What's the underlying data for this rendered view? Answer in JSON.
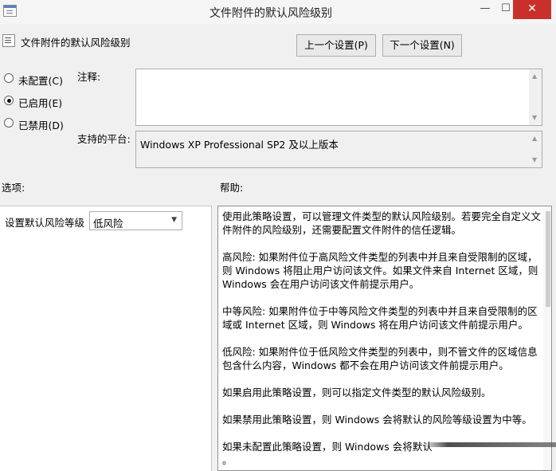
{
  "window": {
    "title": "文件附件的默认风险级别",
    "minimize_glyph": "—",
    "maximize_glyph": "☐",
    "close_glyph": "✕"
  },
  "header": {
    "policy_name": "文件附件的默认风险级别",
    "prev_button": "上一个设置(P)",
    "next_button": "下一个设置(N)"
  },
  "state": {
    "options": [
      {
        "label": "未配置(C)",
        "checked": false
      },
      {
        "label": "已启用(E)",
        "checked": true
      },
      {
        "label": "已禁用(D)",
        "checked": false
      }
    ]
  },
  "comment": {
    "label": "注释:",
    "value": ""
  },
  "platform": {
    "label": "支持的平台:",
    "value": "Windows XP Professional SP2 及以上版本"
  },
  "options_section": {
    "heading": "选项:",
    "risk_label": "设置默认风险等级",
    "risk_value": "低风险"
  },
  "help_section": {
    "heading": "帮助:",
    "paragraphs": [
      "使用此策略设置，可以管理文件类型的默认风险级别。若要完全自定义文件附件的风险级别，还需要配置文件附件的信任逻辑。",
      "高风险: 如果附件位于高风险文件类型的列表中并且来自受限制的区域，则 Windows 将阻止用户访问该文件。如果文件来自 Internet 区域，则 Windows 会在用户访问该文件前提示用户。",
      "中等风险: 如果附件位于中等风险文件类型的列表中并且来自受限制的区域或 Internet 区域，则 Windows 将在用户访问该文件前提示用户。",
      "低风险: 如果附件位于低风险文件类型的列表中，则不管文件的区域信息包含什么内容，Windows 都不会在用户访问该文件前提示用户。",
      "如果启用此策略设置，则可以指定文件类型的默认风险级别。",
      "如果禁用此策略设置，则 Windows 会将默认的风险等级设置为中等。",
      "如果未配置此策略设置，则 Windows 会将默认",
      "。"
    ]
  }
}
